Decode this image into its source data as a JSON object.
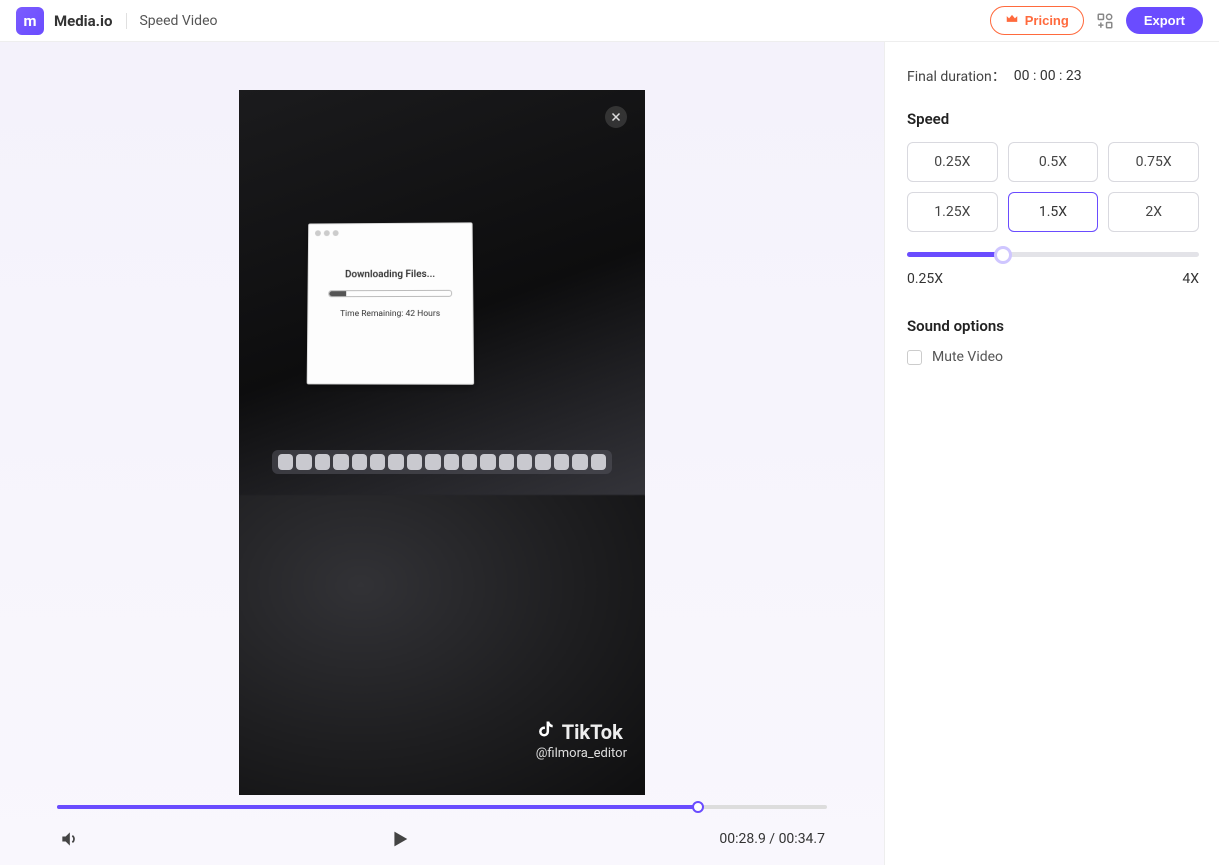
{
  "header": {
    "brand": "Media.io",
    "subtool": "Speed Video",
    "pricing_label": "Pricing",
    "export_label": "Export"
  },
  "video_overlay": {
    "download_title": "Downloading Files...",
    "time_remaining_label": "Time Remaining:",
    "time_remaining_value": "42 Hours",
    "tiktok_label": "TikTok",
    "tiktok_handle": "@filmora_editor"
  },
  "player": {
    "current_time": "00:28.9",
    "total_time": "00:34.7",
    "progress_percent": 83.3
  },
  "panel": {
    "final_duration_label": "Final duration：",
    "final_duration_value": "00 : 00 : 23",
    "speed_title": "Speed",
    "speeds": [
      "0.25X",
      "0.5X",
      "0.75X",
      "1.25X",
      "1.5X",
      "2X"
    ],
    "selected_speed": "1.5X",
    "slider_min_label": "0.25X",
    "slider_max_label": "4X",
    "slider_percent": 33,
    "sound_title": "Sound options",
    "mute_label": "Mute Video"
  },
  "colors": {
    "accent": "#6a4cff",
    "pricing": "#ff6a3d"
  }
}
